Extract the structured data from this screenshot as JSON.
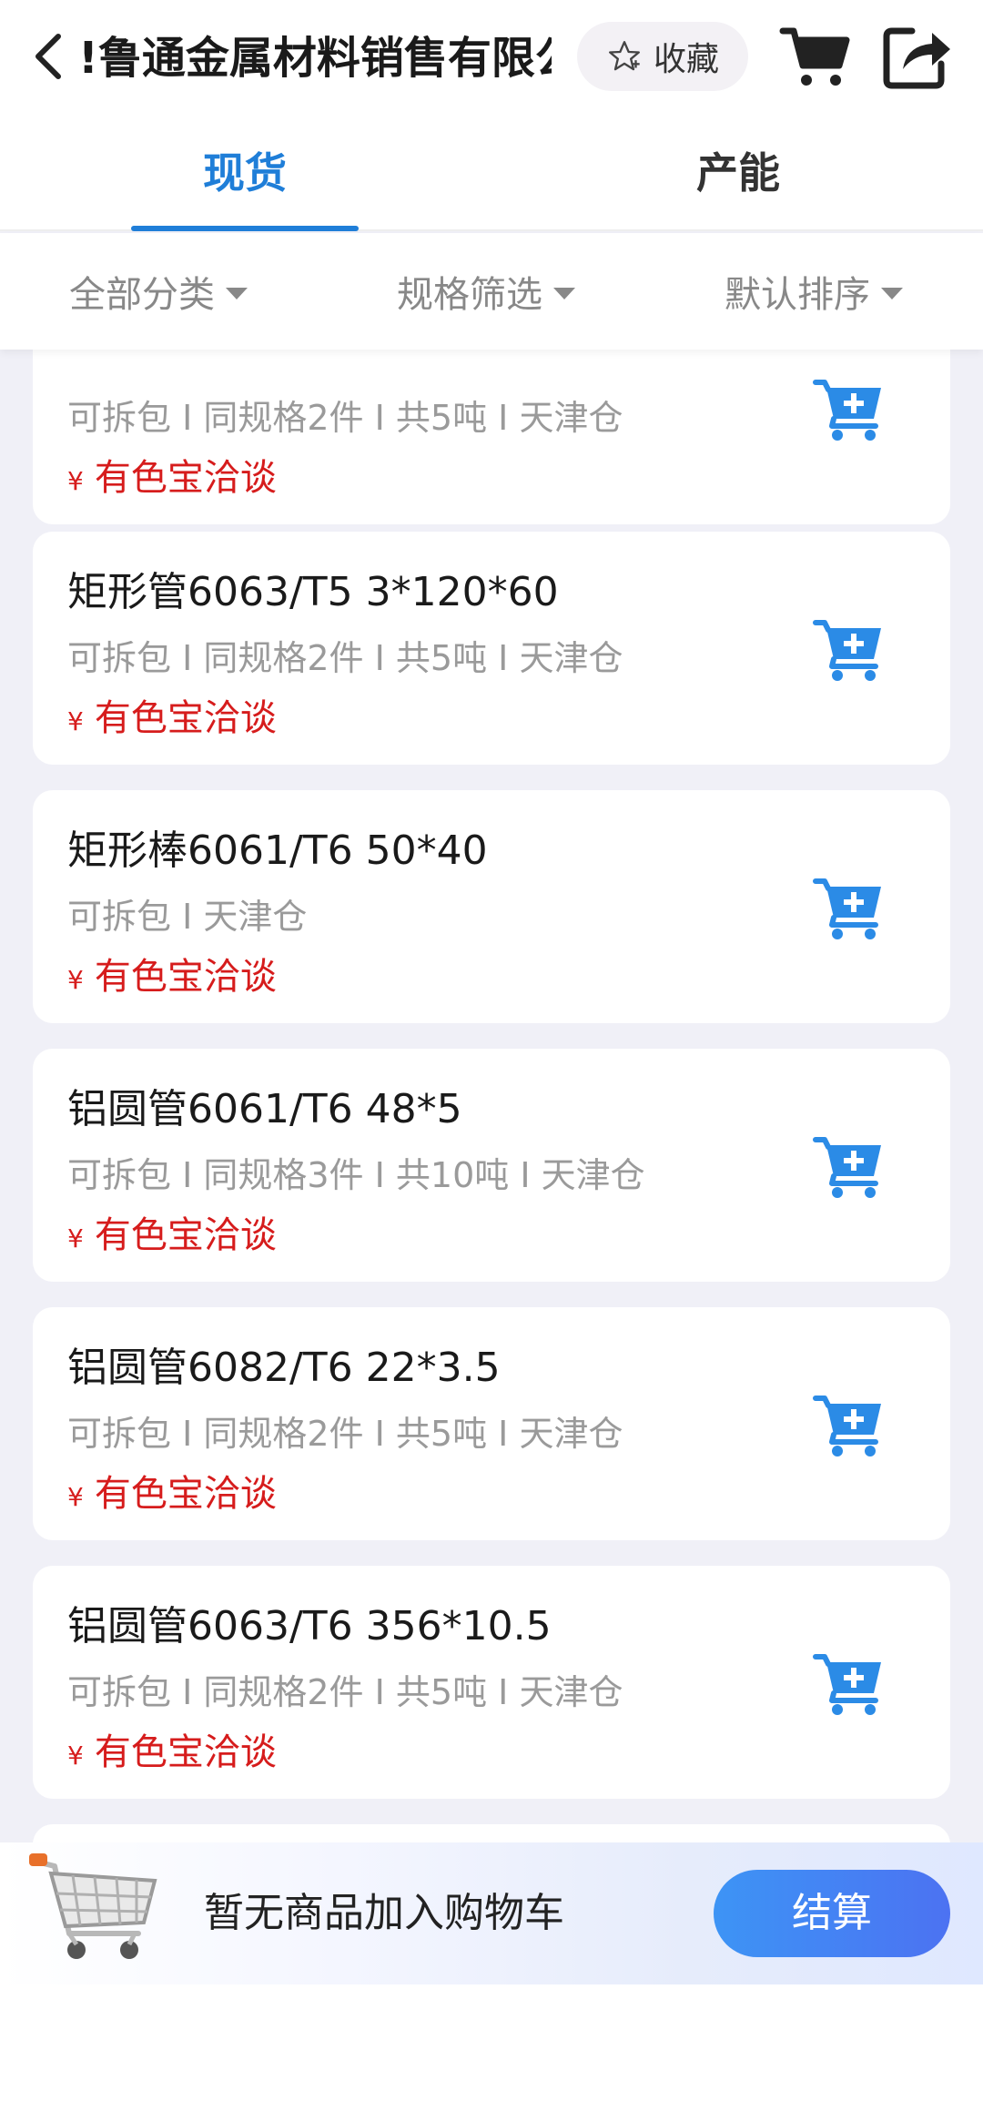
{
  "header": {
    "title": "!鲁通金属材料销售有限公司",
    "favorite_label": "收藏"
  },
  "tabs": [
    {
      "label": "现货",
      "active": true
    },
    {
      "label": "产能",
      "active": false
    }
  ],
  "filters": [
    {
      "label": "全部分类"
    },
    {
      "label": "规格筛选"
    },
    {
      "label": "默认排序"
    }
  ],
  "products": [
    {
      "name": "",
      "meta": "可拆包 I 同规格2件 I 共5吨 I 天津仓",
      "price": "有色宝洽谈"
    },
    {
      "name": "矩形管6063/T5 3*120*60",
      "meta": "可拆包 I 同规格2件 I 共5吨 I 天津仓",
      "price": "有色宝洽谈"
    },
    {
      "name": "矩形棒6061/T6 50*40",
      "meta": "可拆包 I 天津仓",
      "price": "有色宝洽谈"
    },
    {
      "name": "铝圆管6061/T6 48*5",
      "meta": "可拆包 I 同规格3件 I 共10吨 I 天津仓",
      "price": "有色宝洽谈"
    },
    {
      "name": "铝圆管6082/T6 22*3.5",
      "meta": "可拆包 I 同规格2件 I 共5吨 I 天津仓",
      "price": "有色宝洽谈"
    },
    {
      "name": "铝圆管6063/T6 356*10.5",
      "meta": "可拆包 I 同规格2件 I 共5吨 I 天津仓",
      "price": "有色宝洽谈"
    }
  ],
  "currency_symbol": "¥",
  "cart_bar": {
    "empty_text": "暂无商品加入购物车",
    "checkout_label": "结算"
  },
  "colors": {
    "accent": "#1f7ed8",
    "price": "#d61c1c",
    "cart_icon": "#2b8be6"
  }
}
